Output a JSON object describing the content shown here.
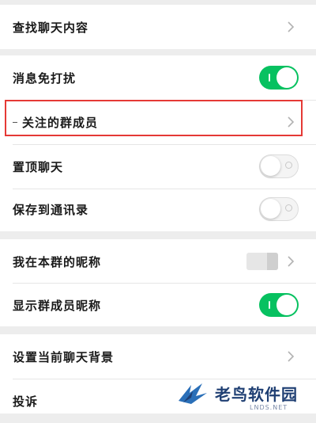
{
  "settings": {
    "search_chat": "查找聊天内容",
    "mute": "消息免打扰",
    "followed_members": "关注的群成员",
    "sticky_top": "置顶聊天",
    "save_contacts": "保存到通讯录",
    "my_group_nickname": "我在本群的昵称",
    "show_member_nicknames": "显示群成员昵称",
    "set_background": "设置当前聊天背景",
    "report": "投诉"
  },
  "toggles": {
    "mute": true,
    "sticky_top": false,
    "save_contacts": false,
    "show_member_nicknames": true
  },
  "icons": {
    "chevron": "chevron-right-icon",
    "logo": "bird-logo-icon"
  },
  "colors": {
    "toggle_on": "#07c160",
    "highlight": "#e53935",
    "watermark": "#1f3f73"
  },
  "watermark": {
    "name": "老鸟软件园",
    "url": "LNDS.NET"
  }
}
